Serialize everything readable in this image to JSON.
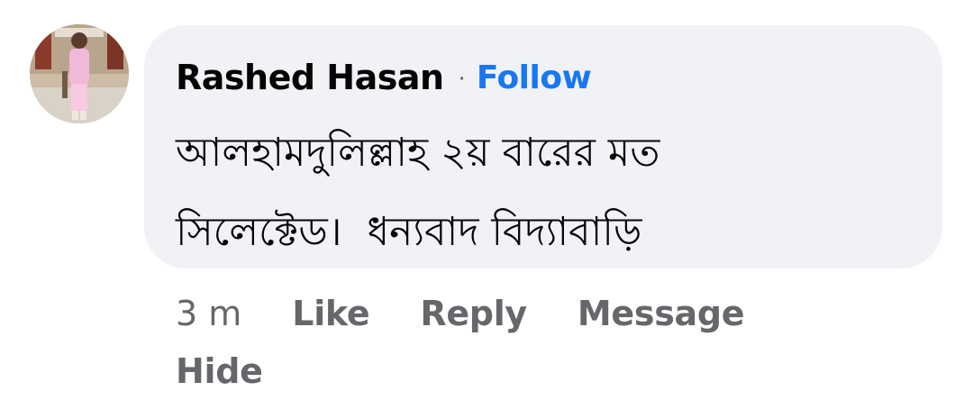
{
  "comment": {
    "author": "Rashed Hasan",
    "separator": "·",
    "follow_label": "Follow",
    "text_line1": "আলহামদুলিল্লাহ ২য় বারের মত",
    "text_line2": "সিলেক্টেড।  ধন্যবাদ বিদ্যাবাড়ি"
  },
  "meta": {
    "timestamp": "3 m",
    "like_label": "Like",
    "reply_label": "Reply",
    "message_label": "Message",
    "hide_label": "Hide"
  },
  "colors": {
    "bubble_bg": "#f0f2f5",
    "link_blue": "#1877f2",
    "meta_gray": "#65676b",
    "text_dark": "#050505"
  }
}
